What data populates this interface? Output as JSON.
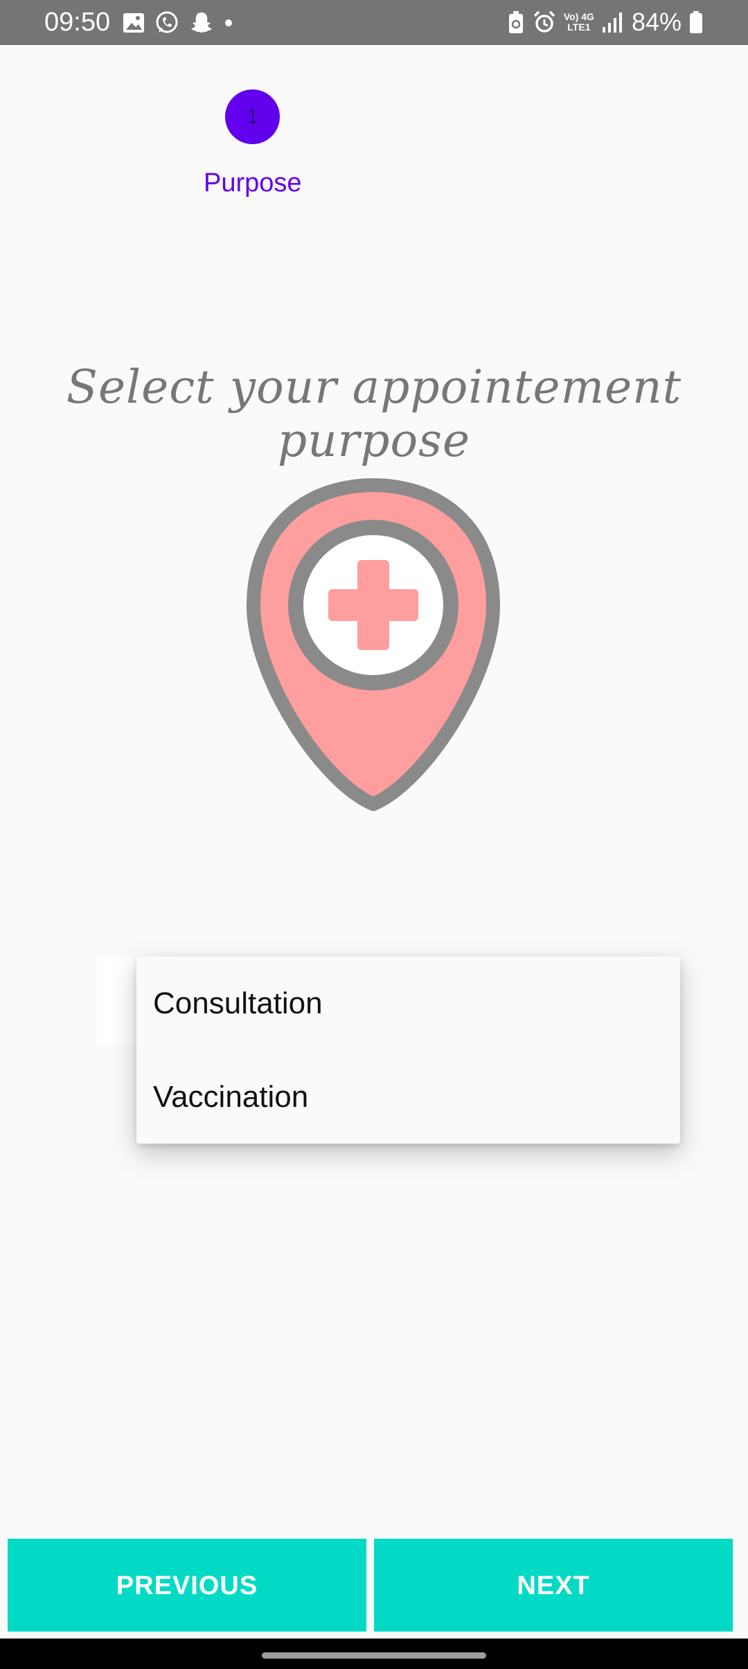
{
  "status_bar": {
    "time": "09:50",
    "battery": "84%",
    "network_top": "Vo) 4G",
    "network_bottom": "LTE1",
    "icons": [
      "image-icon",
      "whatsapp-icon",
      "snapchat-icon",
      "dot-icon",
      "battery-saver-icon",
      "alarm-icon",
      "signal-icon",
      "battery-icon"
    ]
  },
  "stepper": {
    "current_step": "1",
    "current_label": "Purpose"
  },
  "heading": "Select your appointement purpose",
  "dropdown": {
    "options": [
      "Consultation",
      "Vaccination"
    ]
  },
  "buttons": {
    "previous": "PREVIOUS",
    "next": "NEXT"
  },
  "colors": {
    "primary": "#6200ee",
    "accent": "#03dac5",
    "status_bar": "#757575",
    "illustration_fill": "#ff9e9e",
    "illustration_stroke": "#8a8a8a"
  }
}
